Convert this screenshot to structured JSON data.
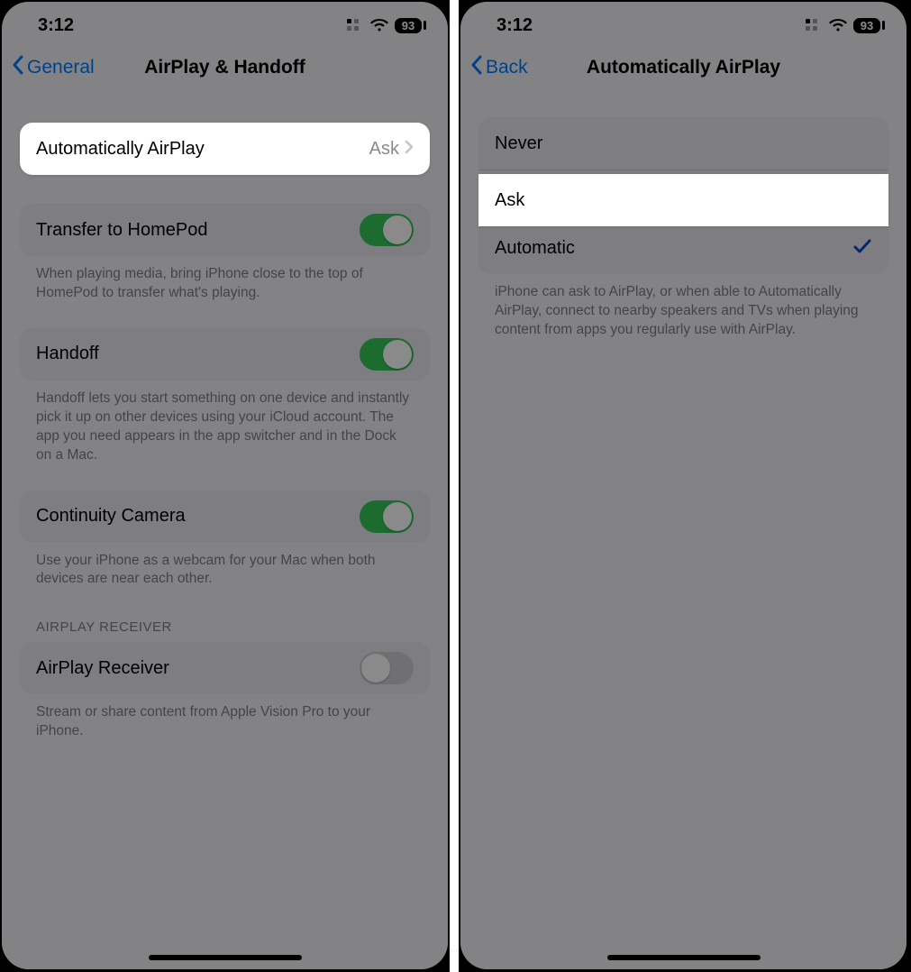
{
  "status": {
    "time": "3:12",
    "battery": "93"
  },
  "left": {
    "back_label": "General",
    "title": "AirPlay & Handoff",
    "auto_airplay": {
      "label": "Automatically AirPlay",
      "value": "Ask"
    },
    "transfer": {
      "label": "Transfer to HomePod",
      "footer": "When playing media, bring iPhone close to the top of HomePod to transfer what's playing."
    },
    "handoff": {
      "label": "Handoff",
      "footer": "Handoff lets you start something on one device and instantly pick it up on other devices using your iCloud account. The app you need appears in the app switcher and in the Dock on a Mac."
    },
    "continuity": {
      "label": "Continuity Camera",
      "footer": "Use your iPhone as a webcam for your Mac when both devices are near each other."
    },
    "receiver_header": "AIRPLAY RECEIVER",
    "receiver": {
      "label": "AirPlay Receiver",
      "footer": "Stream or share content from Apple Vision Pro to your iPhone."
    }
  },
  "right": {
    "back_label": "Back",
    "title": "Automatically AirPlay",
    "options": {
      "never": "Never",
      "ask": "Ask",
      "automatic": "Automatic"
    },
    "footer": "iPhone can ask to AirPlay, or when able to Automatically AirPlay, connect to nearby speakers and TVs when playing content from apps you regularly use with AirPlay."
  }
}
